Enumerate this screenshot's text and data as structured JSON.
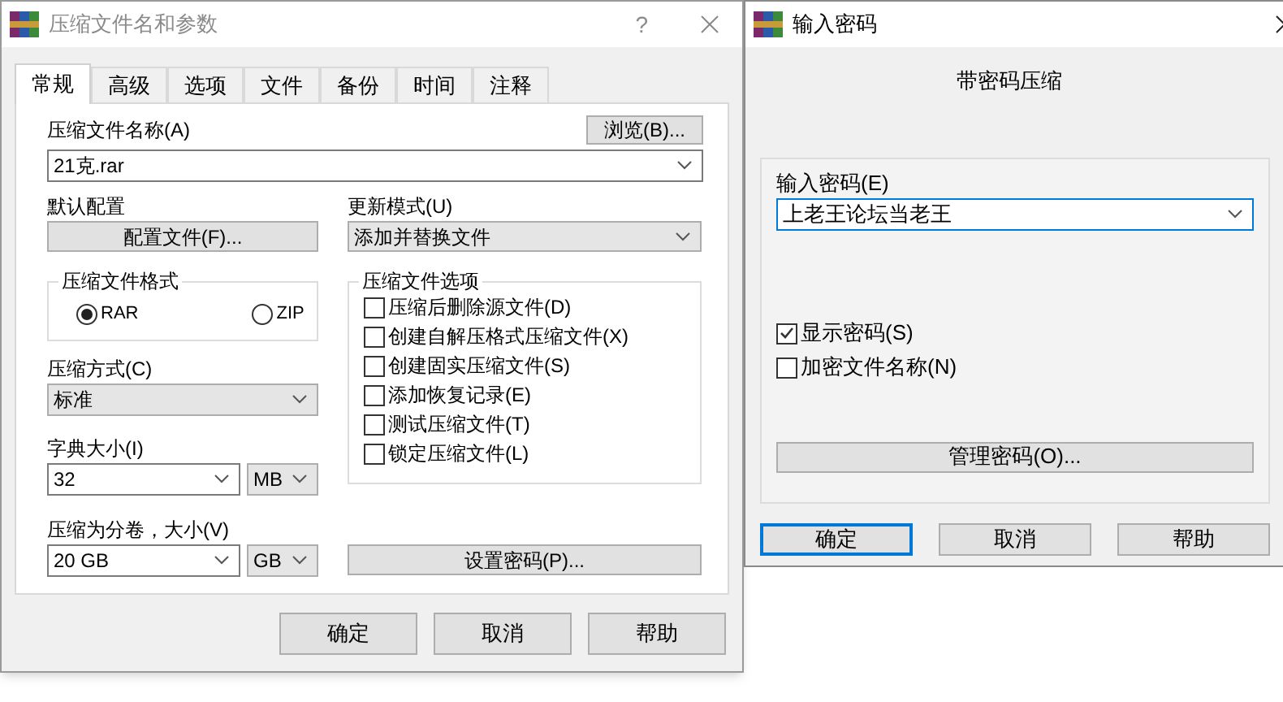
{
  "archive_dialog": {
    "title": "压缩文件名和参数",
    "help_button": "?",
    "tabs": [
      {
        "label": "常规",
        "selected": true
      },
      {
        "label": "高级",
        "selected": false
      },
      {
        "label": "选项",
        "selected": false
      },
      {
        "label": "文件",
        "selected": false
      },
      {
        "label": "备份",
        "selected": false
      },
      {
        "label": "时间",
        "selected": false
      },
      {
        "label": "注释",
        "selected": false
      }
    ],
    "archive_name": {
      "label": "压缩文件名称(A)",
      "value": "21克.rar"
    },
    "browse_button": "浏览(B)...",
    "profile": {
      "label": "默认配置",
      "button": "配置文件(F)..."
    },
    "update_mode": {
      "label": "更新模式(U)",
      "value": "添加并替换文件"
    },
    "format": {
      "label": "压缩文件格式",
      "options": [
        {
          "label": "RAR",
          "selected": true
        },
        {
          "label": "ZIP",
          "selected": false
        }
      ]
    },
    "method": {
      "label": "压缩方式(C)",
      "value": "标准"
    },
    "dictionary": {
      "label": "字典大小(I)",
      "value": "32",
      "unit": "MB"
    },
    "volumes": {
      "label": "压缩为分卷，大小(V)",
      "value": "20 GB",
      "unit": "GB"
    },
    "options": {
      "label": "压缩文件选项",
      "items": [
        {
          "label": "压缩后删除源文件(D)",
          "checked": false
        },
        {
          "label": "创建自解压格式压缩文件(X)",
          "checked": false
        },
        {
          "label": "创建固实压缩文件(S)",
          "checked": false
        },
        {
          "label": "添加恢复记录(E)",
          "checked": false
        },
        {
          "label": "测试压缩文件(T)",
          "checked": false
        },
        {
          "label": "锁定压缩文件(L)",
          "checked": false
        }
      ]
    },
    "password_button": "设置密码(P)...",
    "buttons": [
      {
        "label": "确定",
        "focused": false
      },
      {
        "label": "取消",
        "focused": false
      },
      {
        "label": "帮助",
        "focused": false
      }
    ]
  },
  "password_dialog": {
    "title": "输入密码",
    "heading": "带密码压缩",
    "password": {
      "label": "输入密码(E)",
      "value": "上老王论坛当老王"
    },
    "options": [
      {
        "label": "显示密码(S)",
        "checked": true
      },
      {
        "label": "加密文件名称(N)",
        "checked": false
      }
    ],
    "manage_button": "管理密码(O)...",
    "buttons": [
      {
        "label": "确定",
        "focused": true
      },
      {
        "label": "取消",
        "focused": false
      },
      {
        "label": "帮助",
        "focused": false
      }
    ]
  }
}
